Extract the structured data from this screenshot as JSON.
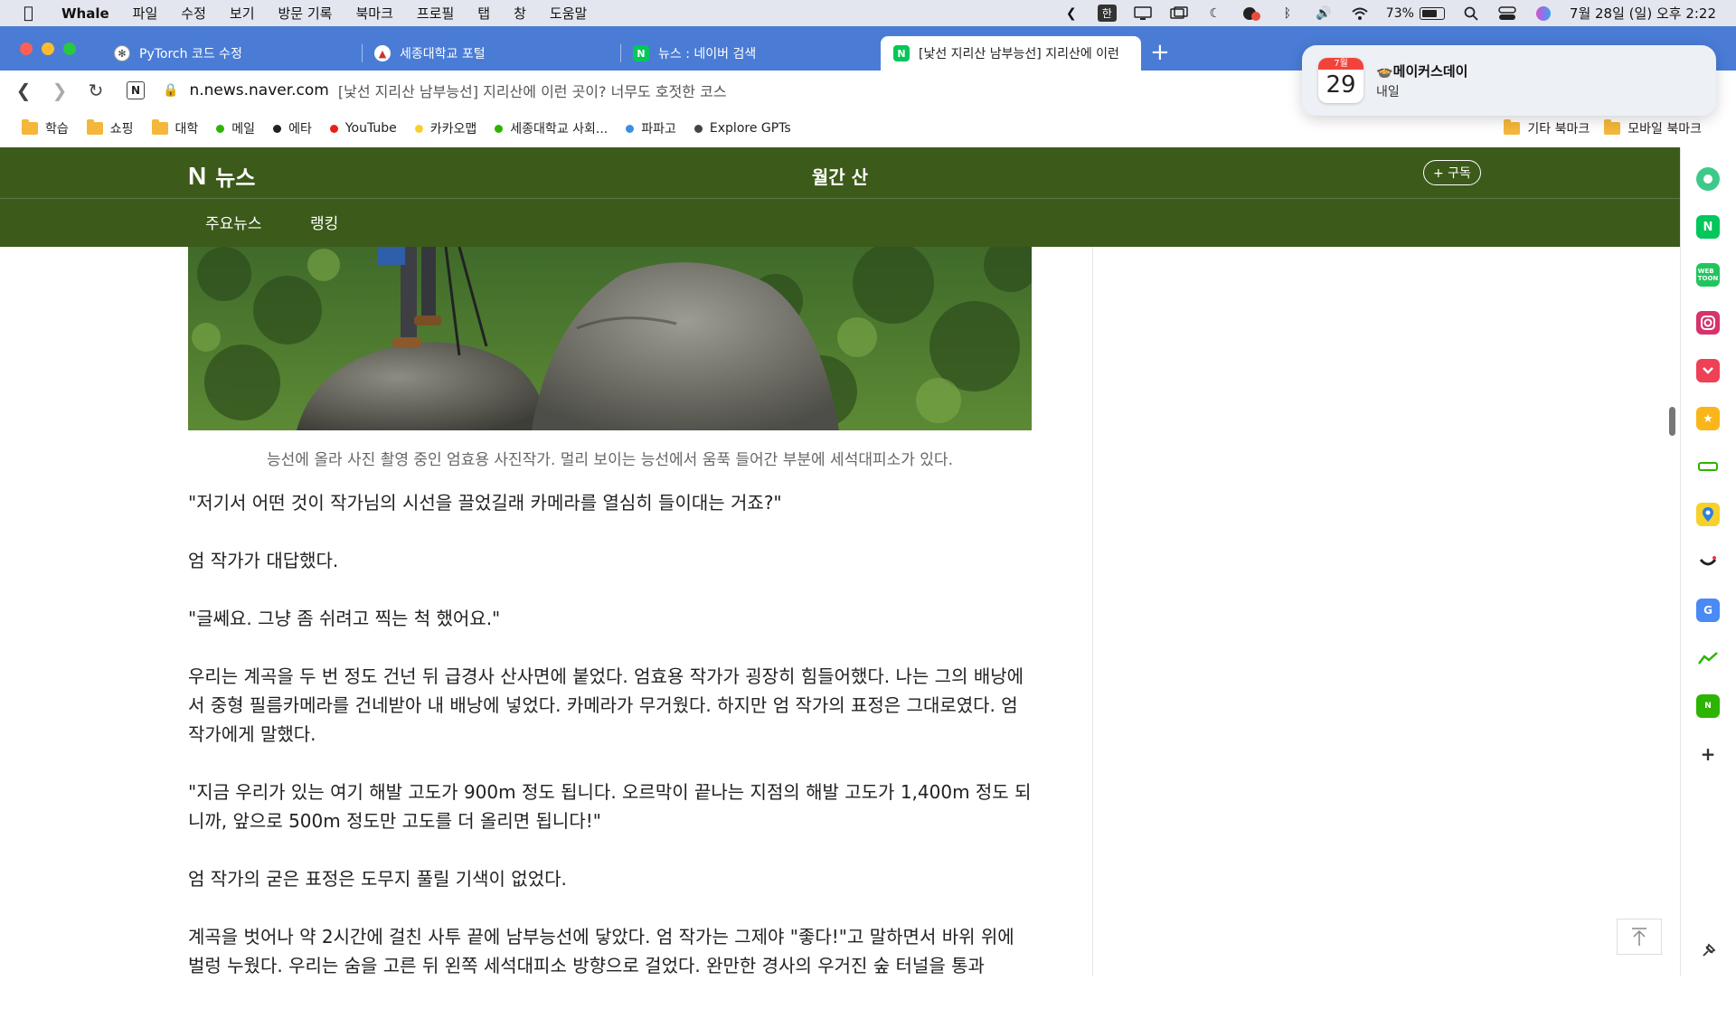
{
  "menubar": {
    "app_name": "Whale",
    "items": [
      "파일",
      "수정",
      "보기",
      "방문 기록",
      "북마크",
      "프로필",
      "탭",
      "창",
      "도움말"
    ],
    "input_indicator": "한",
    "battery": "73%",
    "datetime": "7월 28일 (일) 오후 2:22"
  },
  "tabs": [
    {
      "title": "PyTorch 코드 수정",
      "icon": "chatgpt-icon"
    },
    {
      "title": "세종대학교 포털",
      "icon": "sejong-icon"
    },
    {
      "title": "뉴스 : 네이버 검색",
      "icon": "naver-icon"
    },
    {
      "title": "[낯선 지리산 남부능선] 지리산에 이런",
      "icon": "naver-icon"
    }
  ],
  "address": {
    "domain": "n.news.naver.com",
    "page_title": "[낯선 지리산 남부능선] 지리산에 이런 곳이? 너무도 호젓한 코스"
  },
  "bookmarks": [
    {
      "label": "학습",
      "type": "folder"
    },
    {
      "label": "쇼핑",
      "type": "folder"
    },
    {
      "label": "대학",
      "type": "folder"
    },
    {
      "label": "메일",
      "type": "dot",
      "color": "#2db400"
    },
    {
      "label": "에타",
      "type": "dot",
      "color": "#222222"
    },
    {
      "label": "YouTube",
      "type": "dot",
      "color": "#e62117"
    },
    {
      "label": "카카오맵",
      "type": "dot",
      "color": "#f7d02c"
    },
    {
      "label": "세종대학교 사회...",
      "type": "dot",
      "color": "#2db400"
    },
    {
      "label": "파파고",
      "type": "dot",
      "color": "#3a8ee6"
    },
    {
      "label": "Explore GPTs",
      "type": "dot",
      "color": "#444444"
    }
  ],
  "bookmarks_right": [
    {
      "label": "기타 북마크"
    },
    {
      "label": "모바일 북마크"
    }
  ],
  "notification": {
    "cal_month": "7월",
    "cal_day": "29",
    "title": "🍲메이커스데이",
    "subtitle": "내일"
  },
  "news": {
    "section_label": "뉴스",
    "press_name": "월간 산",
    "subscribe_label": "+ 구독",
    "tabs": [
      "주요뉴스",
      "랭킹"
    ]
  },
  "article": {
    "caption": "능선에 올라 사진 촬영 중인 엄효용 사진작가. 멀리 보이는 능선에서 움푹 들어간 부분에 세석대피소가 있다.",
    "paragraphs": [
      "\"저기서 어떤 것이 작가님의 시선을 끌었길래 카메라를 열심히 들이대는 거죠?\"",
      "엄 작가가 대답했다.",
      "\"글쎄요. 그냥 좀 쉬려고 찍는 척 했어요.\"",
      "우리는 계곡을 두 번 정도 건넌 뒤 급경사 산사면에 붙었다. 엄효용 작가가 굉장히 힘들어했다. 나는 그의 배낭에서 중형 필름카메라를 건네받아 내 배낭에 넣었다. 카메라가 무거웠다. 하지만 엄 작가의 표정은 그대로였다. 엄 작가에게 말했다.",
      "\"지금 우리가 있는 여기 해발 고도가 900m 정도 됩니다. 오르막이 끝나는 지점의 해발 고도가 1,400m 정도 되니까, 앞으로 500m 정도만 고도를 더 올리면 됩니다!\"",
      "엄 작가의 굳은 표정은 도무지 풀릴 기색이 없었다.",
      "계곡을 벗어나 약 2시간에 걸친 사투 끝에 남부능선에 닿았다. 엄 작가는 그제야 \"좋다!\"고 말하면서 바위 위에 벌렁 누웠다. 우리는 숨을 고른 뒤 왼쪽 세석대피소 방향으로 걸었다. 완만한 경사의 우거진 숲 터널을 통과"
    ]
  },
  "sidebar_icons": [
    "whale-green-icon",
    "naver-icon",
    "webtoon-icon",
    "instagram-icon",
    "pocket-icon",
    "star-icon",
    "bar-icon",
    "map-pin-icon",
    "smile-icon",
    "translate-icon",
    "chart-icon",
    "shopping-icon",
    "plus-icon"
  ],
  "colors": {
    "tabbar": "#4a7cd6",
    "news_header": "#3c5a1a",
    "naver_green": "#03c75a"
  }
}
